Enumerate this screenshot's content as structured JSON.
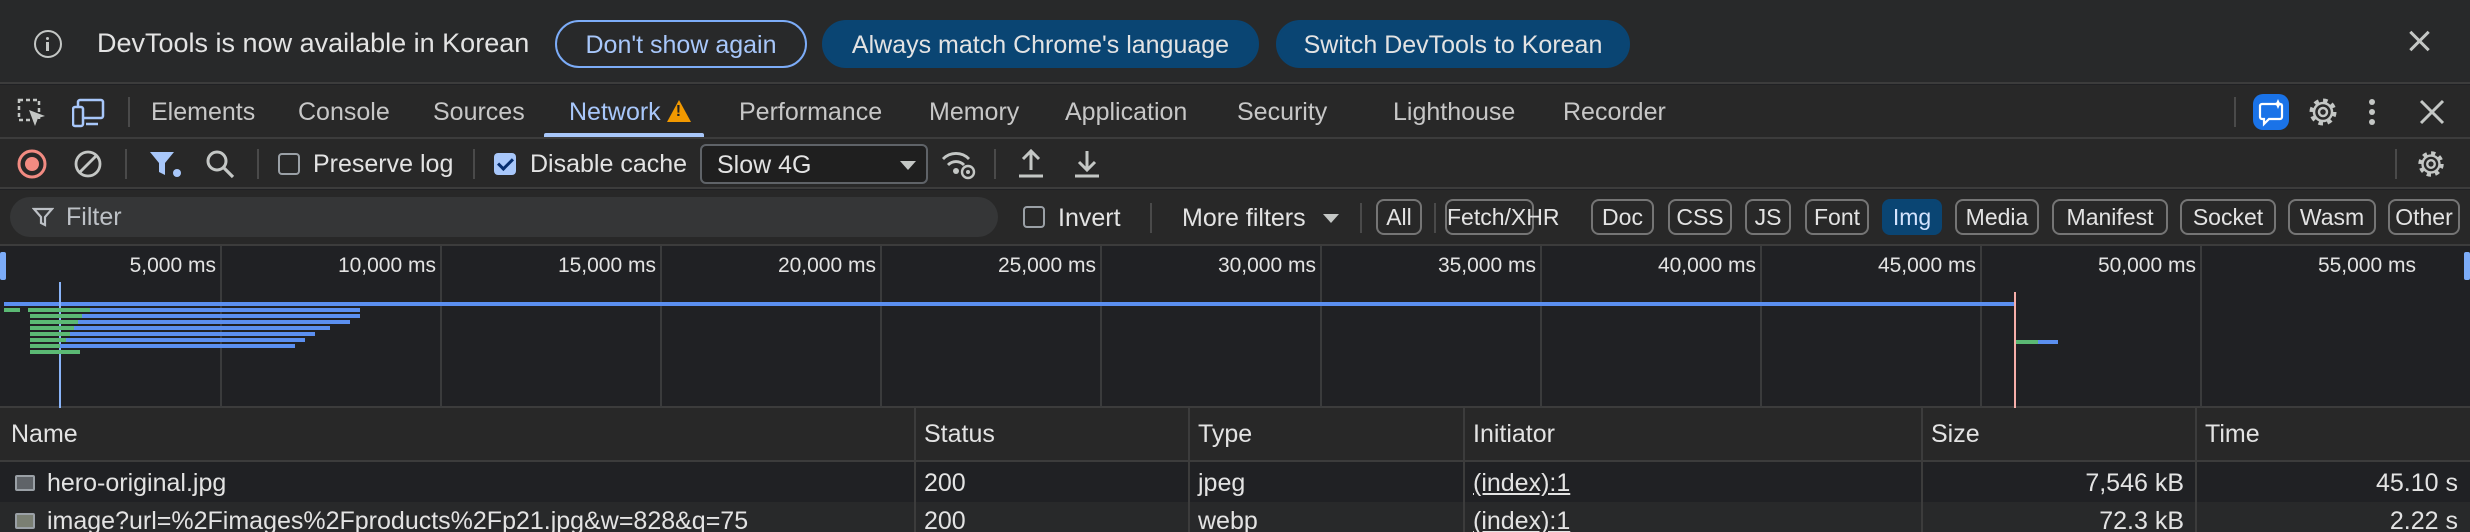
{
  "infobar": {
    "message": "DevTools is now available in Korean",
    "buttons": [
      "Don't show again",
      "Always match Chrome's language",
      "Switch DevTools to Korean"
    ]
  },
  "tabs": [
    "Elements",
    "Console",
    "Sources",
    "Network",
    "Performance",
    "Memory",
    "Application",
    "Security",
    "Lighthouse",
    "Recorder"
  ],
  "active_tab": "Network",
  "toolbar": {
    "preserve_log": "Preserve log",
    "preserve_log_checked": false,
    "disable_cache": "Disable cache",
    "disable_cache_checked": true,
    "throttling": "Slow 4G"
  },
  "filter": {
    "placeholder": "Filter",
    "invert": "Invert",
    "more_filters": "More filters",
    "types": [
      "All",
      "Fetch/XHR",
      "Doc",
      "CSS",
      "JS",
      "Font",
      "Img",
      "Media",
      "Manifest",
      "Socket",
      "Wasm",
      "Other"
    ],
    "active_type": "Img"
  },
  "overview": {
    "ticks": [
      "5,000 ms",
      "10,000 ms",
      "15,000 ms",
      "20,000 ms",
      "25,000 ms",
      "30,000 ms",
      "35,000 ms",
      "40,000 ms",
      "45,000 ms",
      "50,000 ms",
      "55,000 ms"
    ]
  },
  "table": {
    "columns": [
      "Name",
      "Status",
      "Type",
      "Initiator",
      "Size",
      "Time"
    ],
    "rows": [
      {
        "name": "hero-original.jpg",
        "status": "200",
        "type": "jpeg",
        "initiator": "(index):1",
        "size": "7,546 kB",
        "time": "45.10 s"
      },
      {
        "name": "image?url=%2Fimages%2Fproducts%2Fp21.jpg&w=828&q=75",
        "status": "200",
        "type": "webp",
        "initiator": "(index):1",
        "size": "72.3 kB",
        "time": "2.22 s"
      }
    ]
  },
  "colors": {
    "accent": "#a8c7fa",
    "record": "#f28b82",
    "warning": "#f29900",
    "waterfall_blue": "#5b8ff0",
    "waterfall_green": "#5bb974"
  }
}
